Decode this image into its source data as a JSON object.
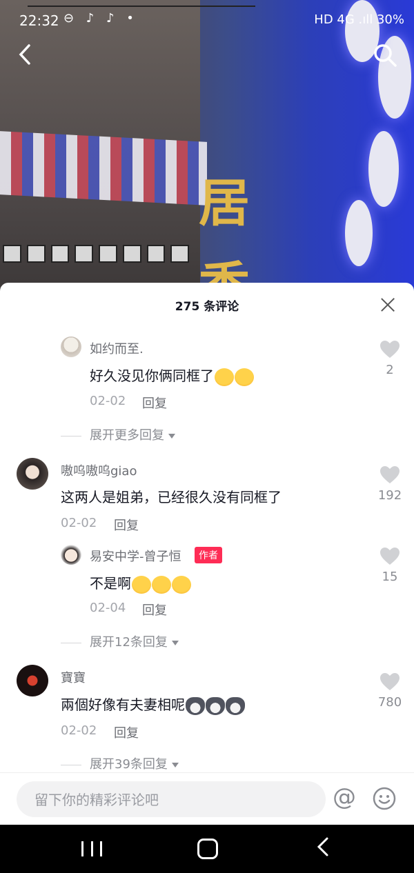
{
  "status_bar": {
    "time": "22:32",
    "indicators": "⊖ ♪ ♪ •",
    "right": "HD 4G .ıll 30%"
  },
  "sheet": {
    "title": "275 条评论"
  },
  "comments": [
    {
      "username": "如约而至.",
      "text": "好久没见你俩同框了",
      "date": "02-02",
      "reply_label": "回复",
      "likes": "2"
    },
    {
      "expand_label": "展开更多回复"
    },
    {
      "username": "嗷呜嗷呜giao",
      "text": "这两人是姐弟，已经很久没有同框了",
      "date": "02-02",
      "reply_label": "回复",
      "likes": "192"
    },
    {
      "username": "易安中学-曾子恒",
      "badge": "作者",
      "text": "不是啊",
      "date": "02-04",
      "reply_label": "回复",
      "likes": "15"
    },
    {
      "expand_label": "展开12条回复"
    },
    {
      "username": "寶寶",
      "text": "兩個好像有夫妻相呢",
      "date": "02-02",
      "reply_label": "回复",
      "likes": "780"
    },
    {
      "expand_label": "展开39条回复"
    }
  ],
  "input": {
    "placeholder": "留下你的精彩评论吧",
    "at_label": "@"
  },
  "video": {
    "sign_char_1": "居",
    "sign_char_2": "香"
  }
}
